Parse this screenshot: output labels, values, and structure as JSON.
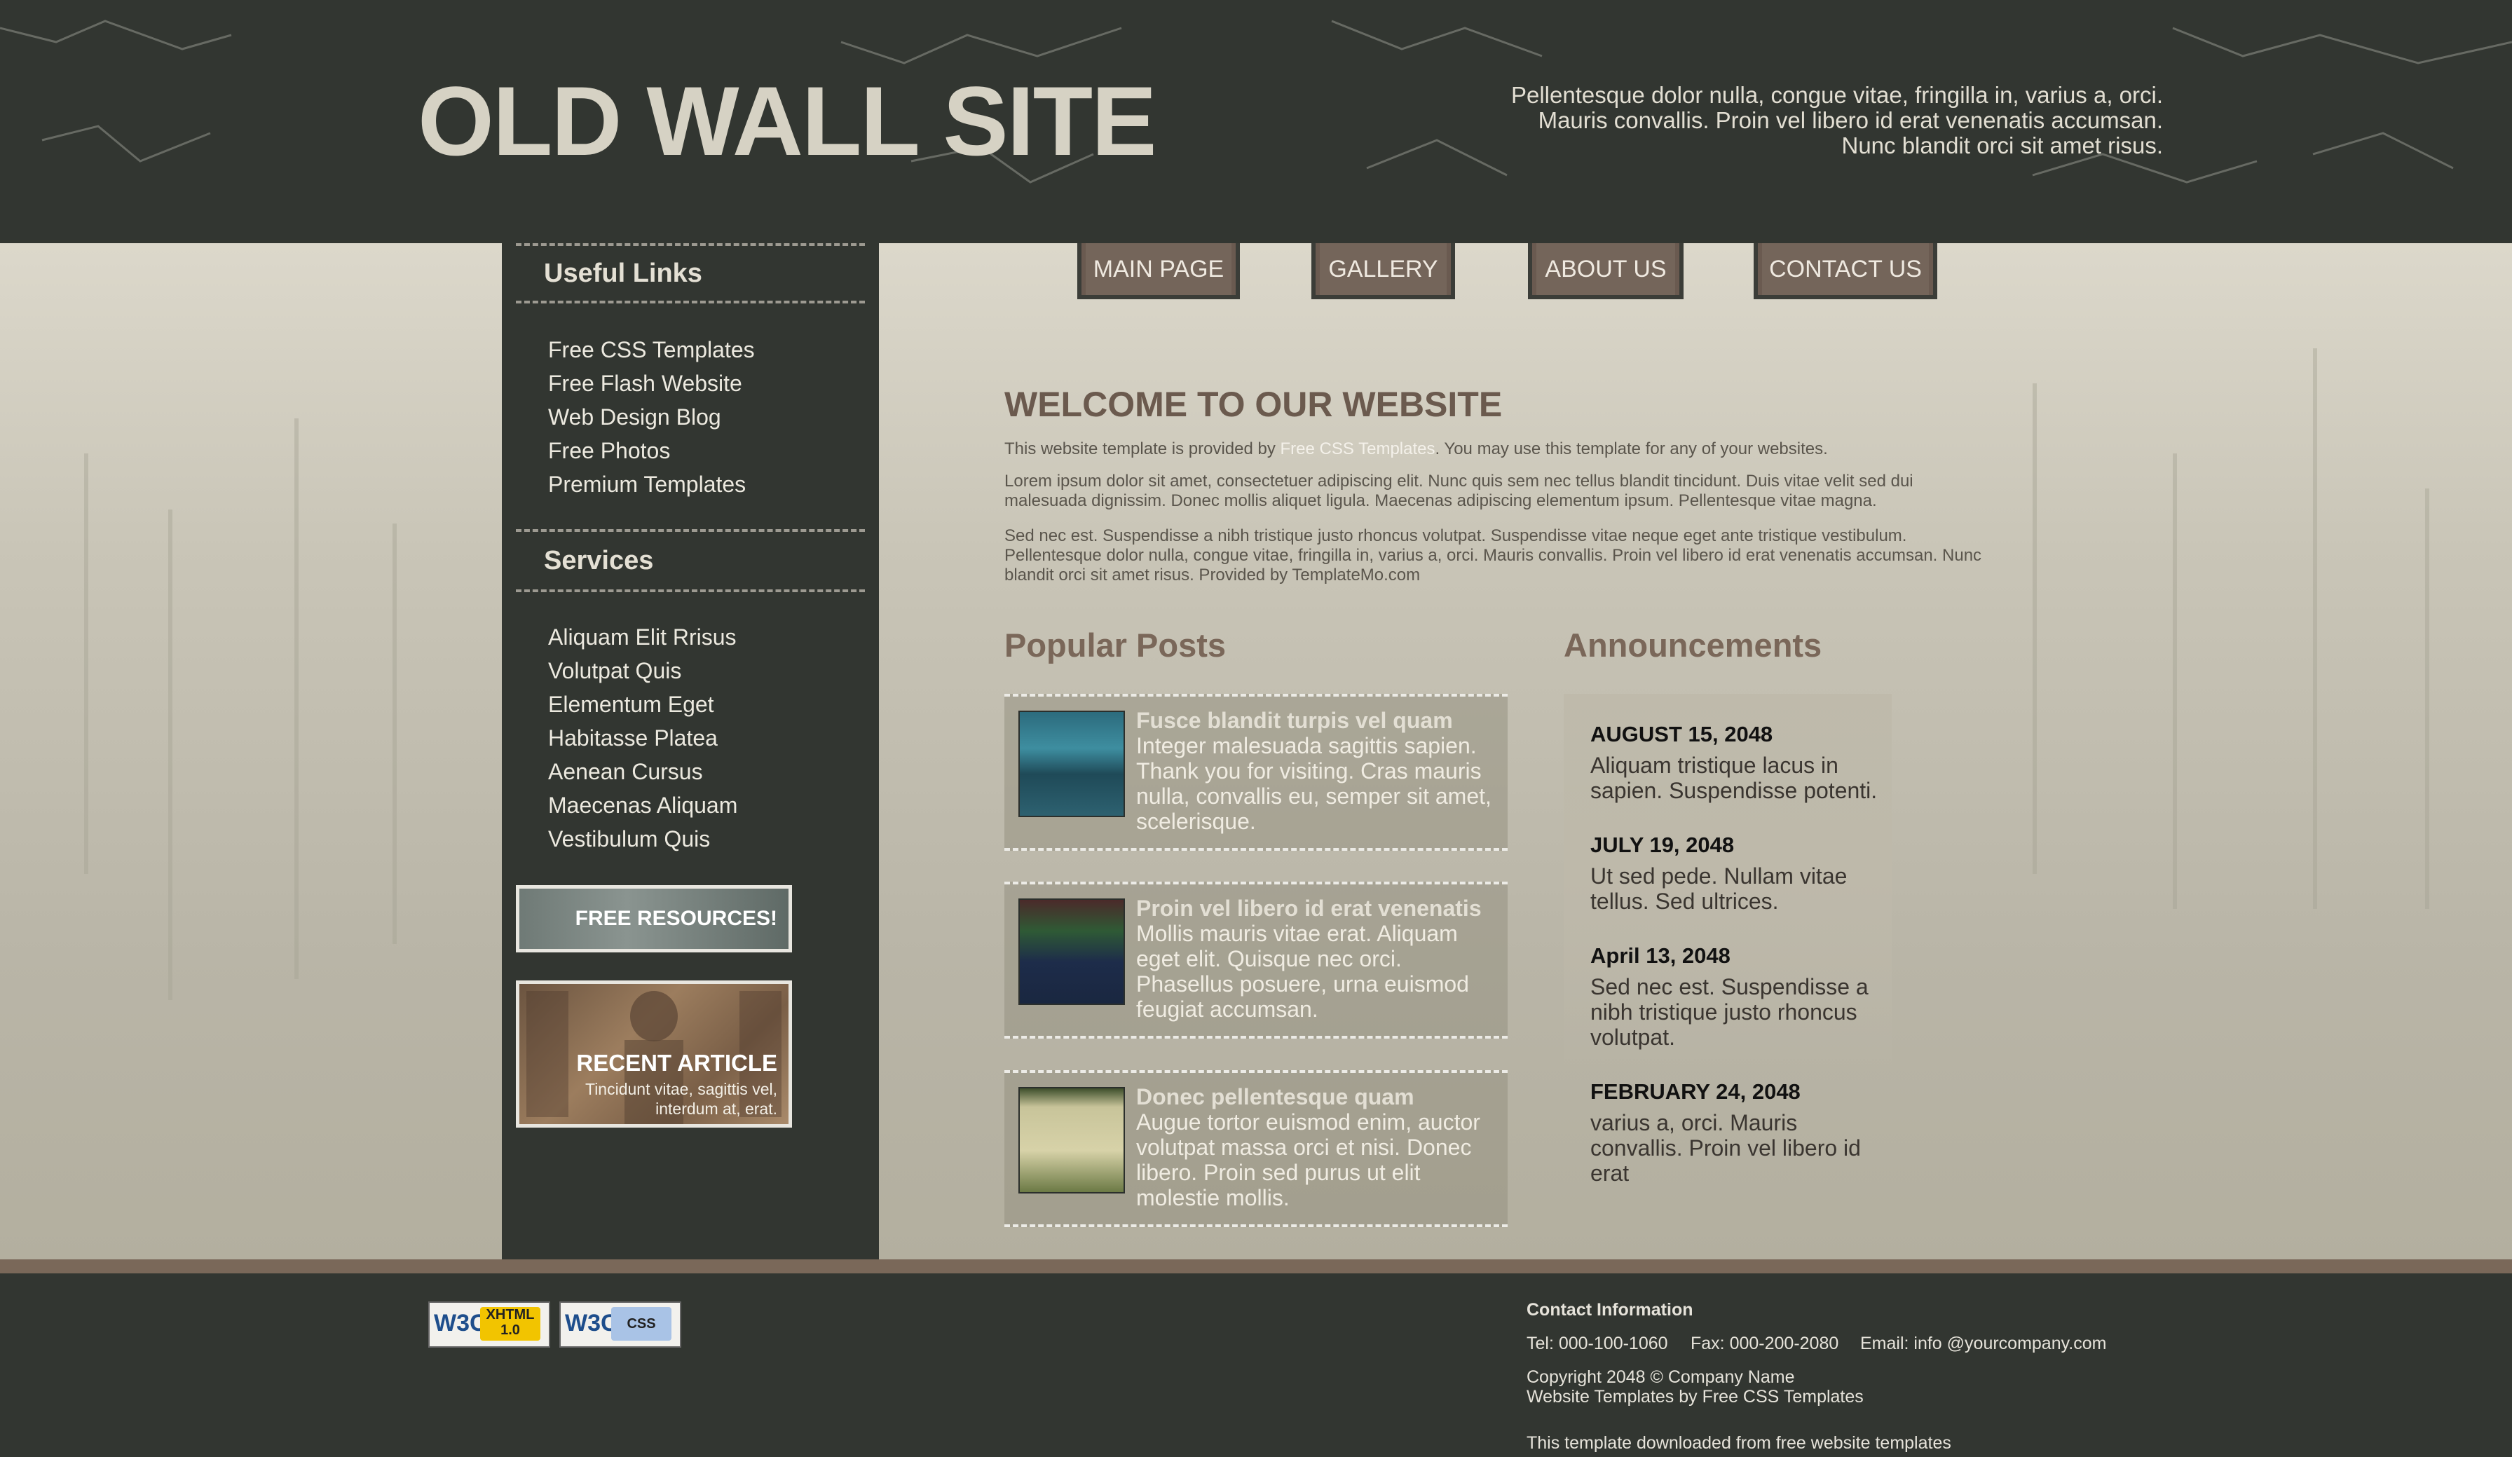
{
  "header": {
    "site_title": "OLD WALL SITE",
    "description_lines": [
      "Pellentesque dolor nulla, congue vitae, fringilla in, varius a, orci.",
      "Mauris convallis. Proin vel libero id erat venenatis accumsan.",
      "Nunc blandit orci sit amet risus."
    ]
  },
  "nav": {
    "items": [
      "MAIN PAGE",
      "GALLERY",
      "ABOUT US",
      "CONTACT US"
    ]
  },
  "sidebar": {
    "useful_links": {
      "title": "Useful Links",
      "items": [
        "Free CSS Templates",
        "Free Flash Website",
        "Web Design Blog",
        "Free Photos",
        "Premium Templates"
      ]
    },
    "services": {
      "title": "Services",
      "items": [
        "Aliquam Elit Rrisus",
        "Volutpat Quis",
        "Elementum Eget",
        "Habitasse Platea",
        "Aenean Cursus",
        "Maecenas Aliquam",
        "Vestibulum Quis"
      ]
    },
    "free_resources": "FREE RESOURCES!",
    "recent_article": {
      "title": "RECENT ARTICLE",
      "lines": [
        "Tincidunt vitae, sagittis vel,",
        "interdum at, erat."
      ]
    }
  },
  "main": {
    "welcome_title": "WELCOME TO OUR WEBSITE",
    "intro": {
      "before": "This website template is provided by ",
      "link": "Free CSS Templates",
      "after": ". You may use this template for any of your websites."
    },
    "para2": "Lorem ipsum dolor sit amet, consectetuer adipiscing elit. Nunc quis sem nec tellus blandit tincidunt. Duis vitae velit sed dui malesuada dignissim. Donec mollis aliquet ligula. Maecenas adipiscing elementum ipsum. Pellentesque vitae magna.",
    "para3": "Sed nec est. Suspendisse a nibh tristique justo rhoncus volutpat. Suspendisse vitae neque eget ante tristique vestibulum. Pellentesque dolor nulla, congue vitae, fringilla in, varius a, orci. Mauris convallis. Proin vel libero id erat venenatis accumsan. Nunc blandit orci sit amet risus. Provided by TemplateMo.com",
    "popular_posts": {
      "title": "Popular Posts",
      "posts": [
        {
          "title": "Fusce blandit turpis vel quam",
          "body": "Integer malesuada sagittis sapien. Thank you for visiting. Cras mauris nulla, convallis eu, semper sit amet, scelerisque."
        },
        {
          "title": "Proin vel libero id erat venenatis",
          "body": "Mollis mauris vitae erat. Aliquam eget elit. Quisque nec orci. Phasellus posuere, urna euismod feugiat accumsan."
        },
        {
          "title": "Donec pellentesque quam",
          "body": "Augue tortor euismod enim, auctor volutpat massa orci et nisi. Donec libero. Proin sed purus ut elit molestie mollis."
        }
      ]
    },
    "announcements": {
      "title": "Announcements",
      "items": [
        {
          "date": "AUGUST 15, 2048",
          "text": "Aliquam tristique lacus in sapien. Suspendisse potenti."
        },
        {
          "date": "JULY 19, 2048",
          "text": "Ut sed pede. Nullam vitae tellus. Sed ultrices."
        },
        {
          "date": "April 13, 2048",
          "text": "Sed nec est. Suspendisse a nibh tristique justo rhoncus volutpat."
        },
        {
          "date": "FEBRUARY 24, 2048",
          "text": "varius a, orci. Mauris convallis. Proin vel libero id erat"
        }
      ]
    }
  },
  "footer": {
    "badges": [
      {
        "w3c": "W3C",
        "label1": "XHTML",
        "label2": "1.0"
      },
      {
        "w3c": "W3C",
        "label1": "CSS",
        "label2": ""
      }
    ],
    "contact_title": "Contact Information",
    "tel": "Tel: 000-100-1060",
    "fax": "Fax: 000-200-2080",
    "email": "Email: info @yourcompany.com",
    "copyright": "Copyright 2048 © Company Name",
    "templates_by": "Website Templates by Free CSS Templates",
    "downloaded": "This template downloaded from free website templates"
  }
}
